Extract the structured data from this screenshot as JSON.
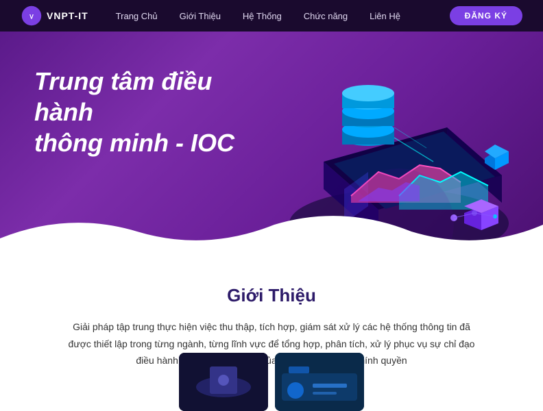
{
  "navbar": {
    "logo_text": "VNPT-IT",
    "links": [
      {
        "label": "Trang Chủ",
        "id": "trang-chu"
      },
      {
        "label": "Giới Thiệu",
        "id": "gioi-thieu"
      },
      {
        "label": "Hệ Thống",
        "id": "he-thong"
      },
      {
        "label": "Chức năng",
        "id": "chuc-nang"
      },
      {
        "label": "Liên Hệ",
        "id": "lien-he"
      }
    ],
    "register_label": "ĐĂNG KÝ"
  },
  "hero": {
    "title_line1": "Trung tâm điều hành",
    "title_line2": "thông minh - IOC"
  },
  "intro": {
    "section_title": "Giới Thiệu",
    "body_text": "Giải pháp tập trung thực hiện việc thu thập, tích hợp, giám sát xử lý các hệ thống thông tin đã được thiết lập trong từng ngành, từng lĩnh vực để tổng hợp, phân tích, xử lý phục vụ sự chỉ đạo điều hành, quản lý nhà nước của các cấp lãnh đạo chính quyền"
  }
}
